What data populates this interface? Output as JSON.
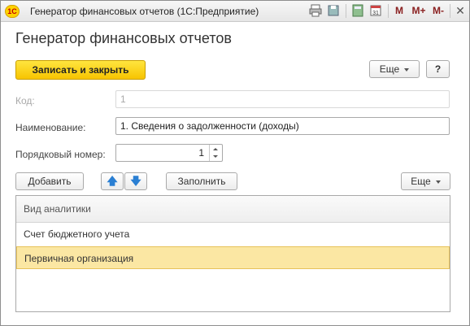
{
  "window": {
    "logo_text": "1С",
    "title": "Генератор финансовых отчетов  (1С:Предприятие)",
    "tb": {
      "m": "M",
      "mplus": "M+",
      "mminus": "M-",
      "minimize": "—",
      "maximize": "☐",
      "close": "✕"
    }
  },
  "form": {
    "title": "Генератор финансовых отчетов",
    "save_close_label": "Записать и закрыть",
    "more_label": "Еще",
    "help_label": "?"
  },
  "fields": {
    "code_label": "Код:",
    "code_value": "1",
    "name_label": "Наименование:",
    "name_value": "1. Сведения о задолженности (доходы)",
    "order_label": "Порядковый номер:",
    "order_value": "1"
  },
  "toolbar": {
    "add_label": "Добавить",
    "up_icon": "arrow-up-icon",
    "down_icon": "arrow-down-icon",
    "fill_label": "Заполнить",
    "more_label": "Еще"
  },
  "table": {
    "header": "Вид аналитики",
    "rows": [
      {
        "label": "Счет бюджетного учета",
        "selected": false
      },
      {
        "label": "Первичная организация",
        "selected": true
      }
    ]
  },
  "colors": {
    "primary_button": "#f7c400",
    "selected_row": "#fbe7a3",
    "arrow_icon": "#2a7fd3"
  }
}
